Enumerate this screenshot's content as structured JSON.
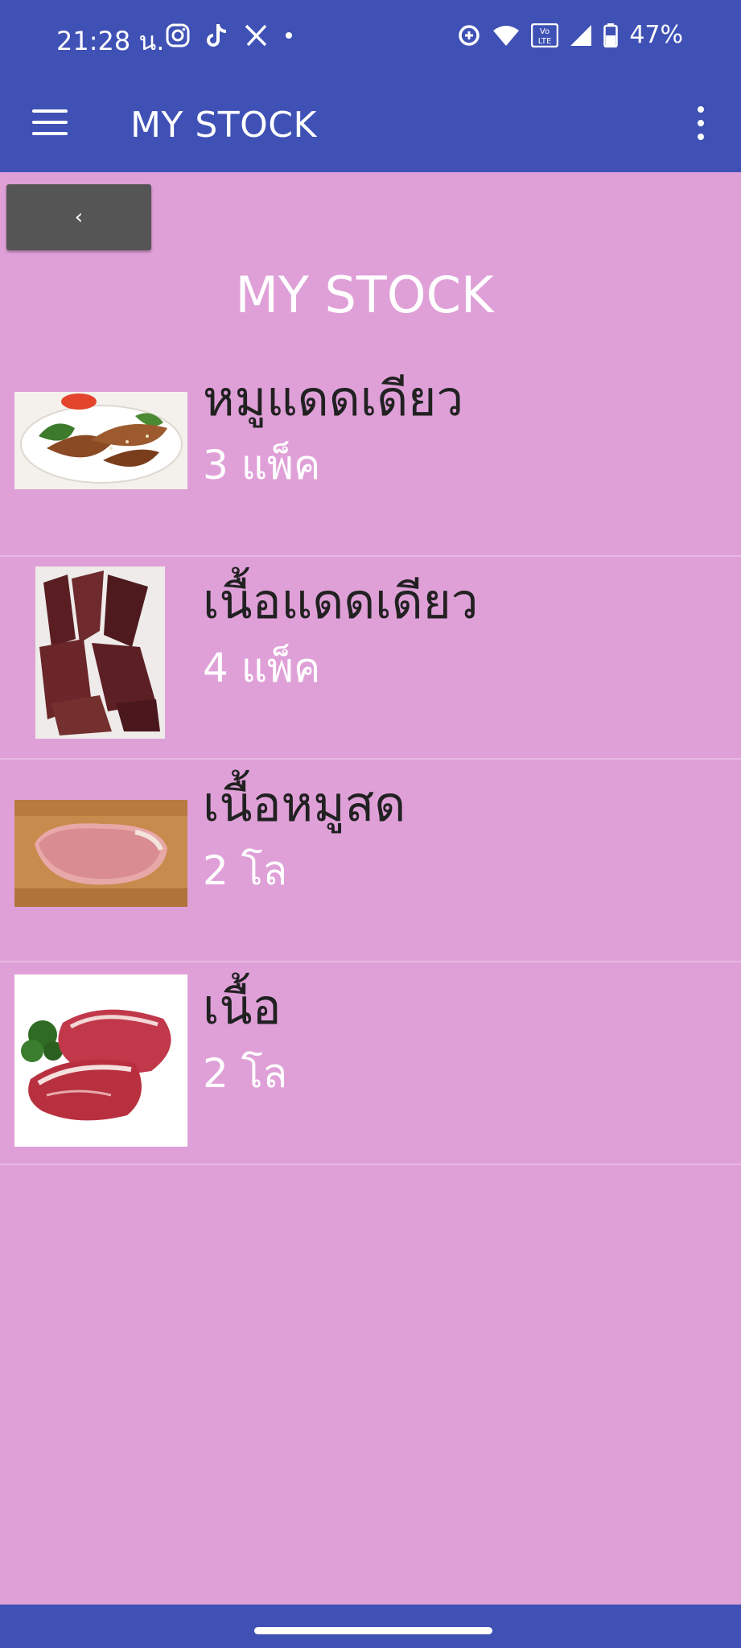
{
  "status_bar": {
    "time": "21:28 น.",
    "battery": "47%",
    "icons": [
      "instagram-icon",
      "tiktok-icon",
      "x-icon",
      "dot-icon",
      "data-saver-icon",
      "wifi-icon",
      "volte-icon",
      "signal-icon",
      "battery-icon"
    ],
    "volte_text": "Vo LTE"
  },
  "app_bar": {
    "title": "MY STOCK",
    "menu_icon": "hamburger-icon",
    "more_icon": "more-vert-icon"
  },
  "back_button": {
    "label": "‹"
  },
  "page_title": "MY STOCK",
  "items": [
    {
      "name": "หมูแดดเดียว",
      "qty": "3 แพ็ค",
      "image": "sun-dried-pork-photo"
    },
    {
      "name": "เนื้อแดดเดียว",
      "qty": "4 แพ็ค",
      "image": "sun-dried-beef-photo"
    },
    {
      "name": "เนื้อหมูสด",
      "qty": "2 โล",
      "image": "fresh-pork-photo"
    },
    {
      "name": "เนื้อ",
      "qty": "2 โล",
      "image": "beef-steak-photo"
    }
  ],
  "colors": {
    "primary": "#3F51B5",
    "background": "#DFA0D8",
    "button": "#555555",
    "item_name": "#212121",
    "item_qty": "#FFFFFF"
  }
}
